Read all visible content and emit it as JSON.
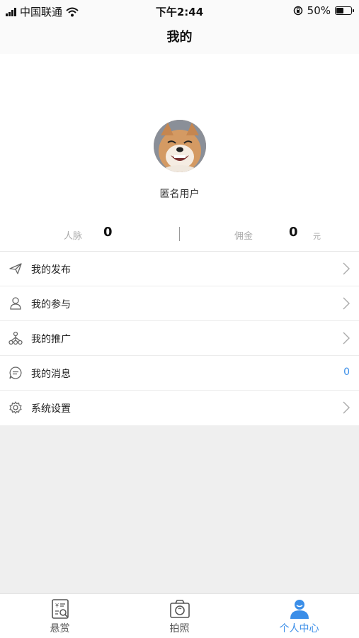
{
  "status_bar": {
    "carrier": "中国联通",
    "time": "下午2:44",
    "battery": "50%",
    "icons": [
      "signal-icon",
      "wifi-icon",
      "orientation-lock-icon",
      "battery-icon"
    ]
  },
  "nav": {
    "title": "我的"
  },
  "profile": {
    "username": "匿名用户",
    "avatar_desc": "shiba-dog-avatar"
  },
  "stats": {
    "connections_label": "人脉",
    "connections_value": "0",
    "commission_label": "佣金",
    "commission_value": "0",
    "commission_unit": "元"
  },
  "menu": {
    "items": [
      {
        "label": "我的发布",
        "icon": "paper-plane-icon"
      },
      {
        "label": "我的参与",
        "icon": "person-icon"
      },
      {
        "label": "我的推广",
        "icon": "network-tree-icon"
      },
      {
        "label": "我的消息",
        "icon": "message-bubble-icon",
        "count": "0"
      },
      {
        "label": "系统设置",
        "icon": "gear-icon"
      }
    ]
  },
  "tabs": [
    {
      "label": "悬赏",
      "icon": "reward-icon",
      "active": false
    },
    {
      "label": "拍照",
      "icon": "camera-icon",
      "active": false
    },
    {
      "label": "个人中心",
      "icon": "user-center-icon",
      "active": true
    }
  ],
  "colors": {
    "accent": "#3b8ee8",
    "background": "#efefef"
  }
}
